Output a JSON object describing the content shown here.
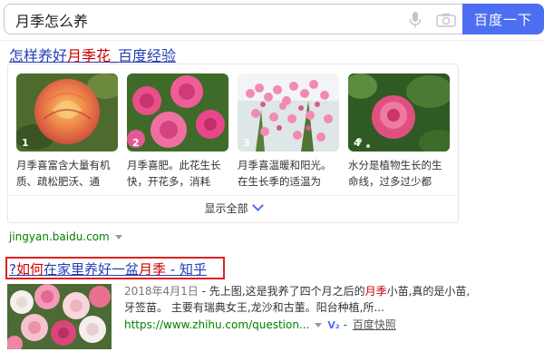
{
  "search": {
    "query": "月季怎么养",
    "button_label": "百度一下"
  },
  "result1": {
    "title_pre": "怎样养好",
    "title_em": "月季花",
    "title_post": "_百度经验",
    "tiles": [
      {
        "num": "1",
        "caption": "月季喜富含大量有机质、疏松肥沃、通气..."
      },
      {
        "num": "2",
        "caption": "月季喜肥。此花生长快，开花多，消耗养..."
      },
      {
        "num": "3",
        "caption": "月季喜温暖和阳光。在生长季的适温为白..."
      },
      {
        "num": "4",
        "caption": "水分是植物生长的生命线，过多过少都会..."
      }
    ],
    "show_all": "显示全部",
    "url": "jingyan.baidu.com"
  },
  "result2": {
    "title_q": "?",
    "title_a": "如何",
    "title_b": "在家里养好一盆",
    "title_em": "月季",
    "title_post": " - 知乎",
    "date": "2018年4月1日",
    "snippet_a": " - 先上图,这是我养了四个月之后的",
    "snippet_em": "月季",
    "snippet_b": "小苗,真的是小苗,牙签苗。 主要有瑞典女王,龙沙和古董。阳台种植,所...",
    "url": "https://www.zhihu.com/question...",
    "badge": "V₂",
    "kuaizhao": "百度快照"
  },
  "icons": {
    "mic": "microphone-icon",
    "camera": "camera-icon"
  },
  "colors": {
    "accent": "#4e6ef2",
    "link": "#2440b3",
    "highlight": "#c00000",
    "url_green": "#008000",
    "annotation_red": "#e02020"
  }
}
